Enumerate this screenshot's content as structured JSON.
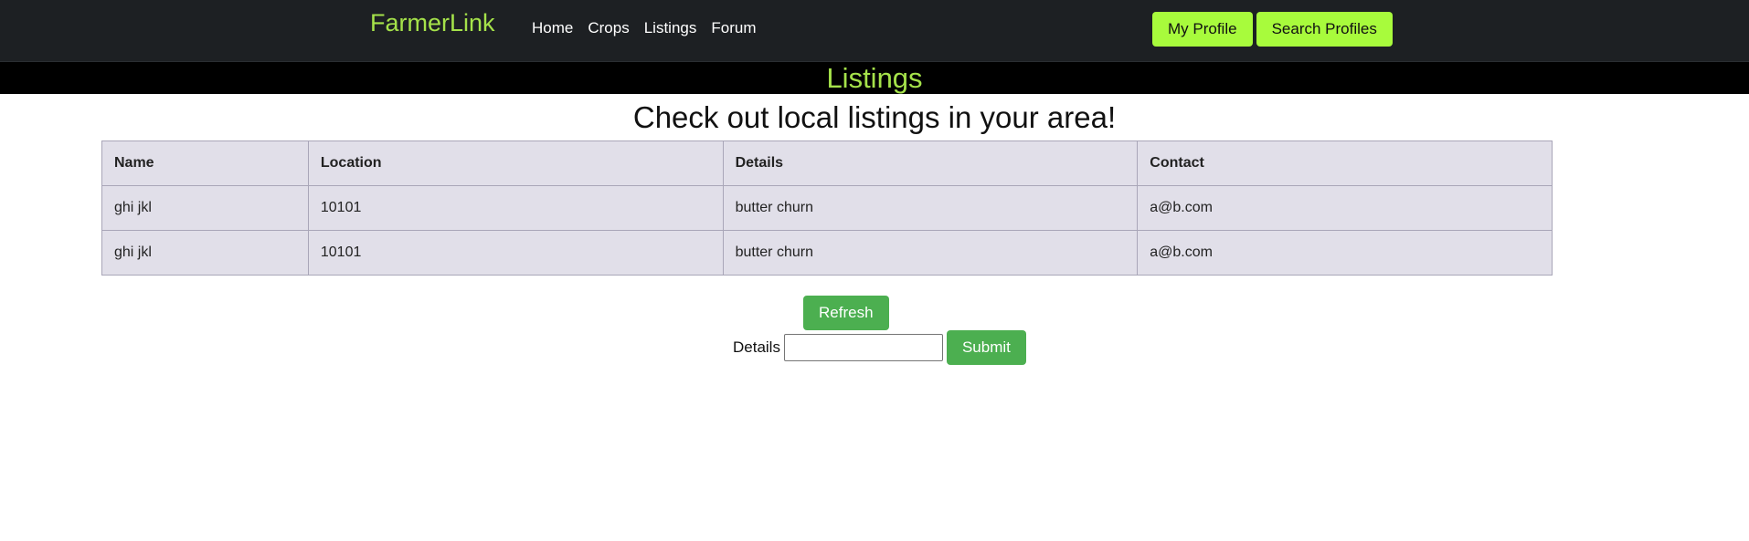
{
  "navbar": {
    "brand": "FarmerLink",
    "links": [
      "Home",
      "Crops",
      "Listings",
      "Forum"
    ],
    "my_profile_label": "My Profile",
    "search_profiles_label": "Search Profiles"
  },
  "banner": {
    "title": "Listings"
  },
  "main": {
    "heading": "Check out local listings in your area!",
    "table": {
      "headers": [
        "Name",
        "Location",
        "Details",
        "Contact"
      ],
      "rows": [
        [
          "ghi jkl",
          "10101",
          "butter churn",
          "a@b.com"
        ],
        [
          "ghi jkl",
          "10101",
          "butter churn",
          "a@b.com"
        ]
      ]
    },
    "refresh_label": "Refresh",
    "form": {
      "details_label": "Details",
      "details_value": "",
      "details_placeholder": "",
      "submit_label": "Submit"
    }
  },
  "colors": {
    "navbar_bg": "#1d2023",
    "brand_green": "#a5e24a",
    "lime_button": "#a8fb3c",
    "green_button": "#4caf50",
    "table_bg": "#e1dfe9"
  }
}
